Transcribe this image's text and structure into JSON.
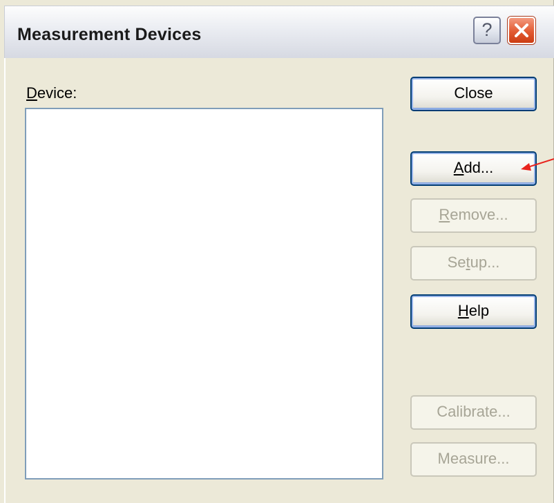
{
  "window": {
    "title": "Measurement Devices",
    "help_glyph": "?",
    "close_glyph": "close-icon"
  },
  "device": {
    "label": "Device:",
    "label_mnemonic": "D",
    "label_rest": "evice:",
    "items": []
  },
  "buttons": [
    {
      "name": "close-button",
      "label": "Close",
      "mnemonic": "",
      "enabled": true
    },
    {
      "name": "add-button",
      "label": "Add...",
      "mnemonic": "A",
      "enabled": true
    },
    {
      "name": "remove-button",
      "label": "Remove...",
      "mnemonic": "R",
      "enabled": false
    },
    {
      "name": "setup-button",
      "label": "Setup...",
      "mnemonic": "t",
      "enabled": false
    },
    {
      "name": "help-button",
      "label": "Help",
      "mnemonic": "H",
      "enabled": true
    },
    {
      "name": "calibrate-button",
      "label": "Calibrate...",
      "mnemonic": "",
      "enabled": false
    },
    {
      "name": "measure-button",
      "label": "Measure...",
      "mnemonic": "",
      "enabled": false
    }
  ],
  "colors": {
    "accent_arrow": "#e8231c",
    "close_button_red": "#e25a32",
    "focus_border": "#003c74"
  }
}
